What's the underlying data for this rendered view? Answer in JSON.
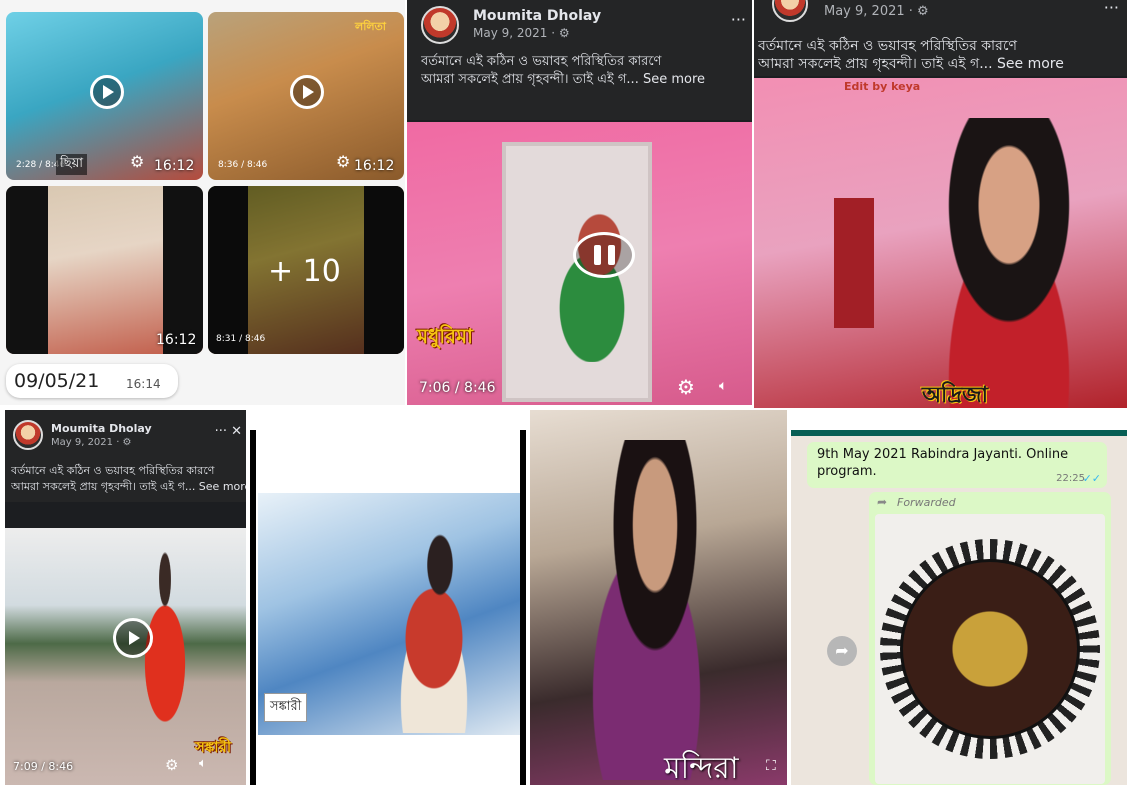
{
  "gallery": {
    "tiles": [
      {
        "name_label": "ছিয়া",
        "duration": "16:12",
        "progress": "2:28 / 8:46"
      },
      {
        "name_label": "ললিতা",
        "duration": "16:12",
        "progress": "8:36 / 8:46"
      },
      {
        "duration": "16:12"
      },
      {
        "more_count": "+ 10",
        "progress": "8:31 / 8:46"
      }
    ],
    "date": "09/05/21",
    "time": "16:14"
  },
  "post_top": {
    "author": "Moumita Dholay",
    "date": "May 9, 2021 · ⚙",
    "text_line1": "বর্তমানে এই কঠিন ও ভয়াবহ পরিস্থিতির কারণে",
    "text_line2": "আমরা সকলেই প্রায় গৃহবন্দী। তাই এই গ... See more",
    "video_caption": "মধুরিমা",
    "video_progress": "7:06 / 8:46"
  },
  "post_right": {
    "date": "May 9, 2021 · ⚙",
    "text_line1": "বর্তমানে এই কঠিন ও ভয়াবহ পরিস্থিতির কারণে",
    "text_line2": "আমরা সকলেই প্রায় গৃহবন্দী। তাই এই গ... See more",
    "edit_credit": "Edit by keya",
    "video_caption": "অদ্রিজা"
  },
  "post_bottom": {
    "author": "Moumita Dholay",
    "date": "May 9, 2021 · ⚙",
    "more": "··· ✕",
    "text_line1": "বর্তমানে এই কঠিন ও ভয়াবহ পরিস্থিতির কারণে",
    "text_line2": "আমরা সকলেই প্রায় গৃহবন্দী। তাই এই গ... See more",
    "video_caption": "সঙ্কারী",
    "video_progress": "7:09 / 8:46"
  },
  "photo_sky": {
    "caption": "সঙ্কারী"
  },
  "photo_indoor": {
    "caption": "মন্দিরা"
  },
  "whatsapp": {
    "message_text": "9th May 2021  Rabindra Jayanti. Online program.",
    "message_time": "22:25",
    "forwarded_label": "Forwarded"
  },
  "colors": {
    "fb_dark": "#242526",
    "whatsapp_bubble": "#dcf8c6",
    "whatsapp_bg": "#ece5dd",
    "caption_yellow": "#f6c512"
  }
}
